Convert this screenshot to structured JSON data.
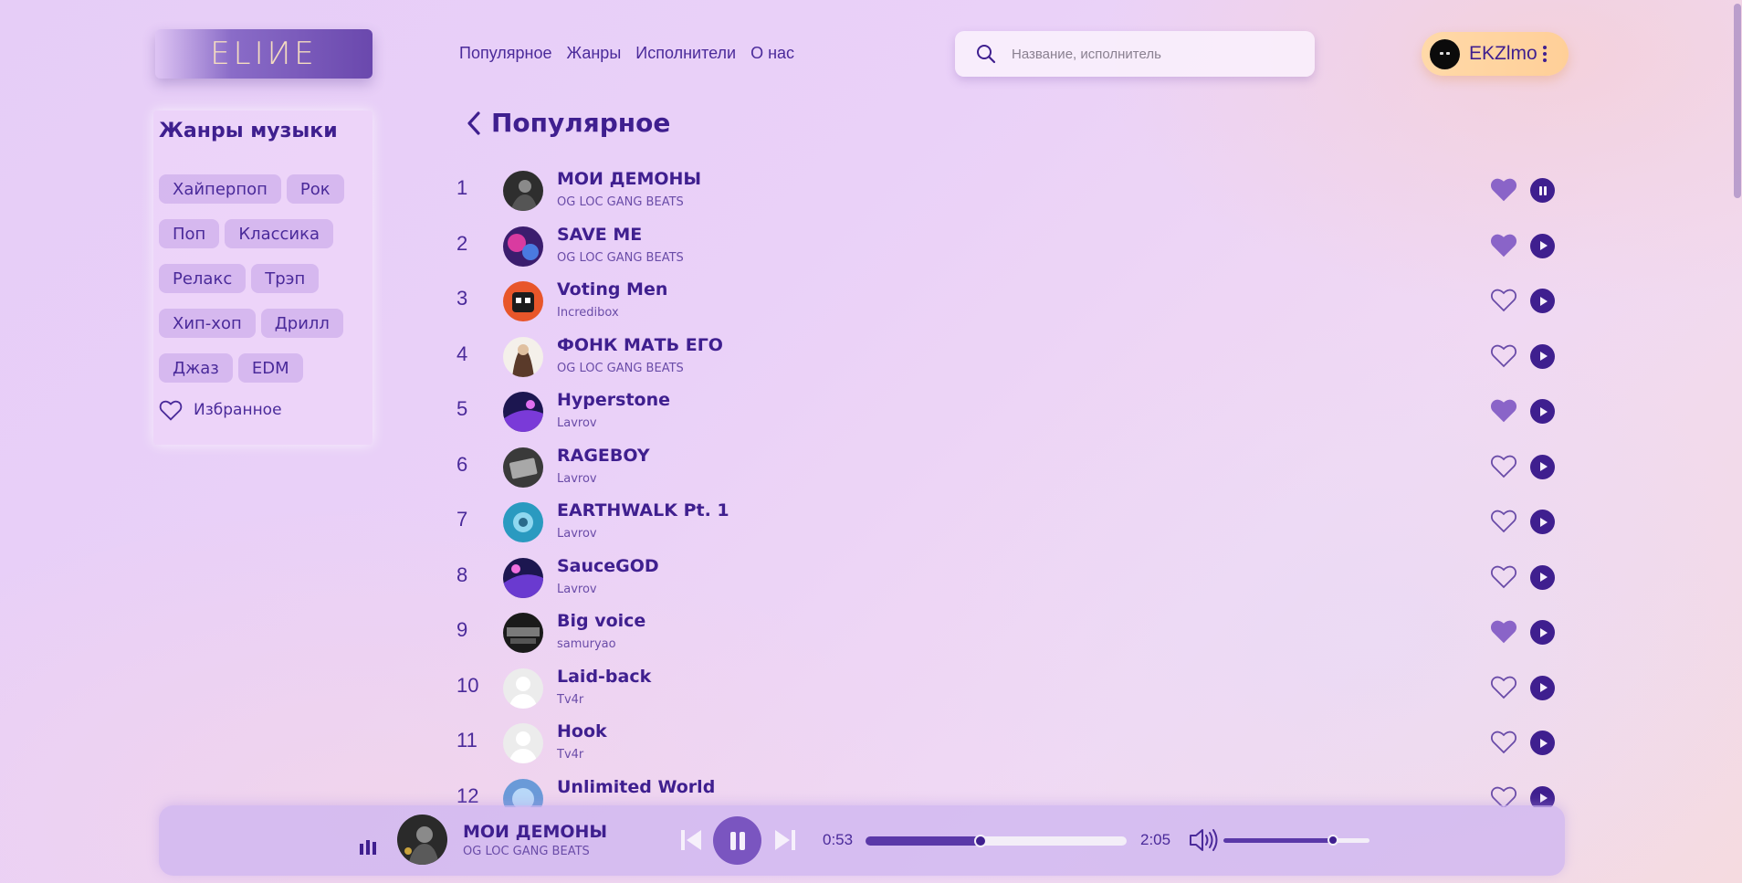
{
  "brand": {
    "logo": "ELIИE"
  },
  "nav": [
    "Популярное",
    "Жанры",
    "Исполнители",
    "О нас"
  ],
  "search": {
    "placeholder": "Название, исполнитель",
    "icon": "search-icon"
  },
  "user": {
    "name": "EKZlmo",
    "menu_icon": "kebab-icon"
  },
  "genres": {
    "title": "Жанры музыки",
    "items": [
      "Хайперпоп",
      "Рок",
      "Поп",
      "Классика",
      "Релакс",
      "Трэп",
      "Хип-хоп",
      "Дрилл",
      "Джаз",
      "EDM"
    ],
    "favorites_label": "Избранное"
  },
  "page": {
    "title": "Популярное"
  },
  "tracks": [
    {
      "n": "1",
      "title": "МОИ ДЕМОНЫ",
      "artist": "OG LOC GANG BEATS",
      "liked": true,
      "playing": true
    },
    {
      "n": "2",
      "title": "SAVE ME",
      "artist": "OG LOC GANG BEATS",
      "liked": true,
      "playing": false
    },
    {
      "n": "3",
      "title": "Voting Men",
      "artist": "Incredibox",
      "liked": false,
      "playing": false
    },
    {
      "n": "4",
      "title": "ФОНК МАТЬ ЕГО",
      "artist": "OG LOC GANG BEATS",
      "liked": false,
      "playing": false
    },
    {
      "n": "5",
      "title": "Hyperstone",
      "artist": "Lavrov",
      "liked": true,
      "playing": false
    },
    {
      "n": "6",
      "title": "RAGEBOY",
      "artist": "Lavrov",
      "liked": false,
      "playing": false
    },
    {
      "n": "7",
      "title": "EARTHWALK Pt. 1",
      "artist": "Lavrov",
      "liked": false,
      "playing": false
    },
    {
      "n": "8",
      "title": "SauceGOD",
      "artist": "Lavrov",
      "liked": false,
      "playing": false
    },
    {
      "n": "9",
      "title": "Big voice",
      "artist": "samuryao",
      "liked": true,
      "playing": false
    },
    {
      "n": "10",
      "title": "Laid-back",
      "artist": "Tv4r",
      "liked": false,
      "playing": false
    },
    {
      "n": "11",
      "title": "Hook",
      "artist": "Tv4r",
      "liked": false,
      "playing": false
    },
    {
      "n": "12",
      "title": "Unlimited World",
      "artist": "",
      "liked": false,
      "playing": false
    }
  ],
  "player": {
    "title": "МОИ ДЕМОНЫ",
    "artist": "OG LOC GANG BEATS",
    "current_time": "0:53",
    "total_time": "2:05",
    "progress": 0.44,
    "volume": 0.75
  },
  "colors": {
    "accent": "#3f1f8f",
    "like_filled": "#8a64c8",
    "user_pill": "#ffd29e"
  }
}
